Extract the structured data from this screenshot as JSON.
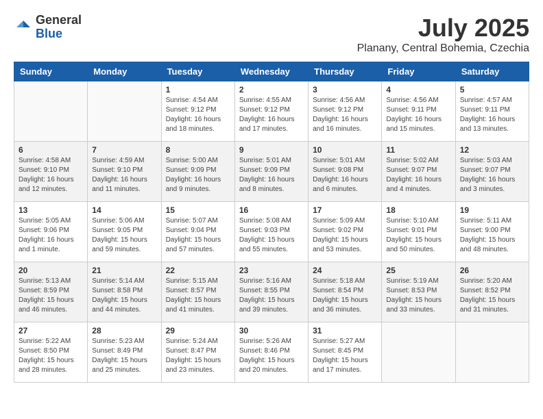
{
  "header": {
    "logo_general": "General",
    "logo_blue": "Blue",
    "month_year": "July 2025",
    "location": "Planany, Central Bohemia, Czechia"
  },
  "weekdays": [
    "Sunday",
    "Monday",
    "Tuesday",
    "Wednesday",
    "Thursday",
    "Friday",
    "Saturday"
  ],
  "weeks": [
    [
      {
        "day": "",
        "info": ""
      },
      {
        "day": "",
        "info": ""
      },
      {
        "day": "1",
        "info": "Sunrise: 4:54 AM\nSunset: 9:12 PM\nDaylight: 16 hours and 18 minutes."
      },
      {
        "day": "2",
        "info": "Sunrise: 4:55 AM\nSunset: 9:12 PM\nDaylight: 16 hours and 17 minutes."
      },
      {
        "day": "3",
        "info": "Sunrise: 4:56 AM\nSunset: 9:12 PM\nDaylight: 16 hours and 16 minutes."
      },
      {
        "day": "4",
        "info": "Sunrise: 4:56 AM\nSunset: 9:11 PM\nDaylight: 16 hours and 15 minutes."
      },
      {
        "day": "5",
        "info": "Sunrise: 4:57 AM\nSunset: 9:11 PM\nDaylight: 16 hours and 13 minutes."
      }
    ],
    [
      {
        "day": "6",
        "info": "Sunrise: 4:58 AM\nSunset: 9:10 PM\nDaylight: 16 hours and 12 minutes."
      },
      {
        "day": "7",
        "info": "Sunrise: 4:59 AM\nSunset: 9:10 PM\nDaylight: 16 hours and 11 minutes."
      },
      {
        "day": "8",
        "info": "Sunrise: 5:00 AM\nSunset: 9:09 PM\nDaylight: 16 hours and 9 minutes."
      },
      {
        "day": "9",
        "info": "Sunrise: 5:01 AM\nSunset: 9:09 PM\nDaylight: 16 hours and 8 minutes."
      },
      {
        "day": "10",
        "info": "Sunrise: 5:01 AM\nSunset: 9:08 PM\nDaylight: 16 hours and 6 minutes."
      },
      {
        "day": "11",
        "info": "Sunrise: 5:02 AM\nSunset: 9:07 PM\nDaylight: 16 hours and 4 minutes."
      },
      {
        "day": "12",
        "info": "Sunrise: 5:03 AM\nSunset: 9:07 PM\nDaylight: 16 hours and 3 minutes."
      }
    ],
    [
      {
        "day": "13",
        "info": "Sunrise: 5:05 AM\nSunset: 9:06 PM\nDaylight: 16 hours and 1 minute."
      },
      {
        "day": "14",
        "info": "Sunrise: 5:06 AM\nSunset: 9:05 PM\nDaylight: 15 hours and 59 minutes."
      },
      {
        "day": "15",
        "info": "Sunrise: 5:07 AM\nSunset: 9:04 PM\nDaylight: 15 hours and 57 minutes."
      },
      {
        "day": "16",
        "info": "Sunrise: 5:08 AM\nSunset: 9:03 PM\nDaylight: 15 hours and 55 minutes."
      },
      {
        "day": "17",
        "info": "Sunrise: 5:09 AM\nSunset: 9:02 PM\nDaylight: 15 hours and 53 minutes."
      },
      {
        "day": "18",
        "info": "Sunrise: 5:10 AM\nSunset: 9:01 PM\nDaylight: 15 hours and 50 minutes."
      },
      {
        "day": "19",
        "info": "Sunrise: 5:11 AM\nSunset: 9:00 PM\nDaylight: 15 hours and 48 minutes."
      }
    ],
    [
      {
        "day": "20",
        "info": "Sunrise: 5:13 AM\nSunset: 8:59 PM\nDaylight: 15 hours and 46 minutes."
      },
      {
        "day": "21",
        "info": "Sunrise: 5:14 AM\nSunset: 8:58 PM\nDaylight: 15 hours and 44 minutes."
      },
      {
        "day": "22",
        "info": "Sunrise: 5:15 AM\nSunset: 8:57 PM\nDaylight: 15 hours and 41 minutes."
      },
      {
        "day": "23",
        "info": "Sunrise: 5:16 AM\nSunset: 8:55 PM\nDaylight: 15 hours and 39 minutes."
      },
      {
        "day": "24",
        "info": "Sunrise: 5:18 AM\nSunset: 8:54 PM\nDaylight: 15 hours and 36 minutes."
      },
      {
        "day": "25",
        "info": "Sunrise: 5:19 AM\nSunset: 8:53 PM\nDaylight: 15 hours and 33 minutes."
      },
      {
        "day": "26",
        "info": "Sunrise: 5:20 AM\nSunset: 8:52 PM\nDaylight: 15 hours and 31 minutes."
      }
    ],
    [
      {
        "day": "27",
        "info": "Sunrise: 5:22 AM\nSunset: 8:50 PM\nDaylight: 15 hours and 28 minutes."
      },
      {
        "day": "28",
        "info": "Sunrise: 5:23 AM\nSunset: 8:49 PM\nDaylight: 15 hours and 25 minutes."
      },
      {
        "day": "29",
        "info": "Sunrise: 5:24 AM\nSunset: 8:47 PM\nDaylight: 15 hours and 23 minutes."
      },
      {
        "day": "30",
        "info": "Sunrise: 5:26 AM\nSunset: 8:46 PM\nDaylight: 15 hours and 20 minutes."
      },
      {
        "day": "31",
        "info": "Sunrise: 5:27 AM\nSunset: 8:45 PM\nDaylight: 15 hours and 17 minutes."
      },
      {
        "day": "",
        "info": ""
      },
      {
        "day": "",
        "info": ""
      }
    ]
  ]
}
